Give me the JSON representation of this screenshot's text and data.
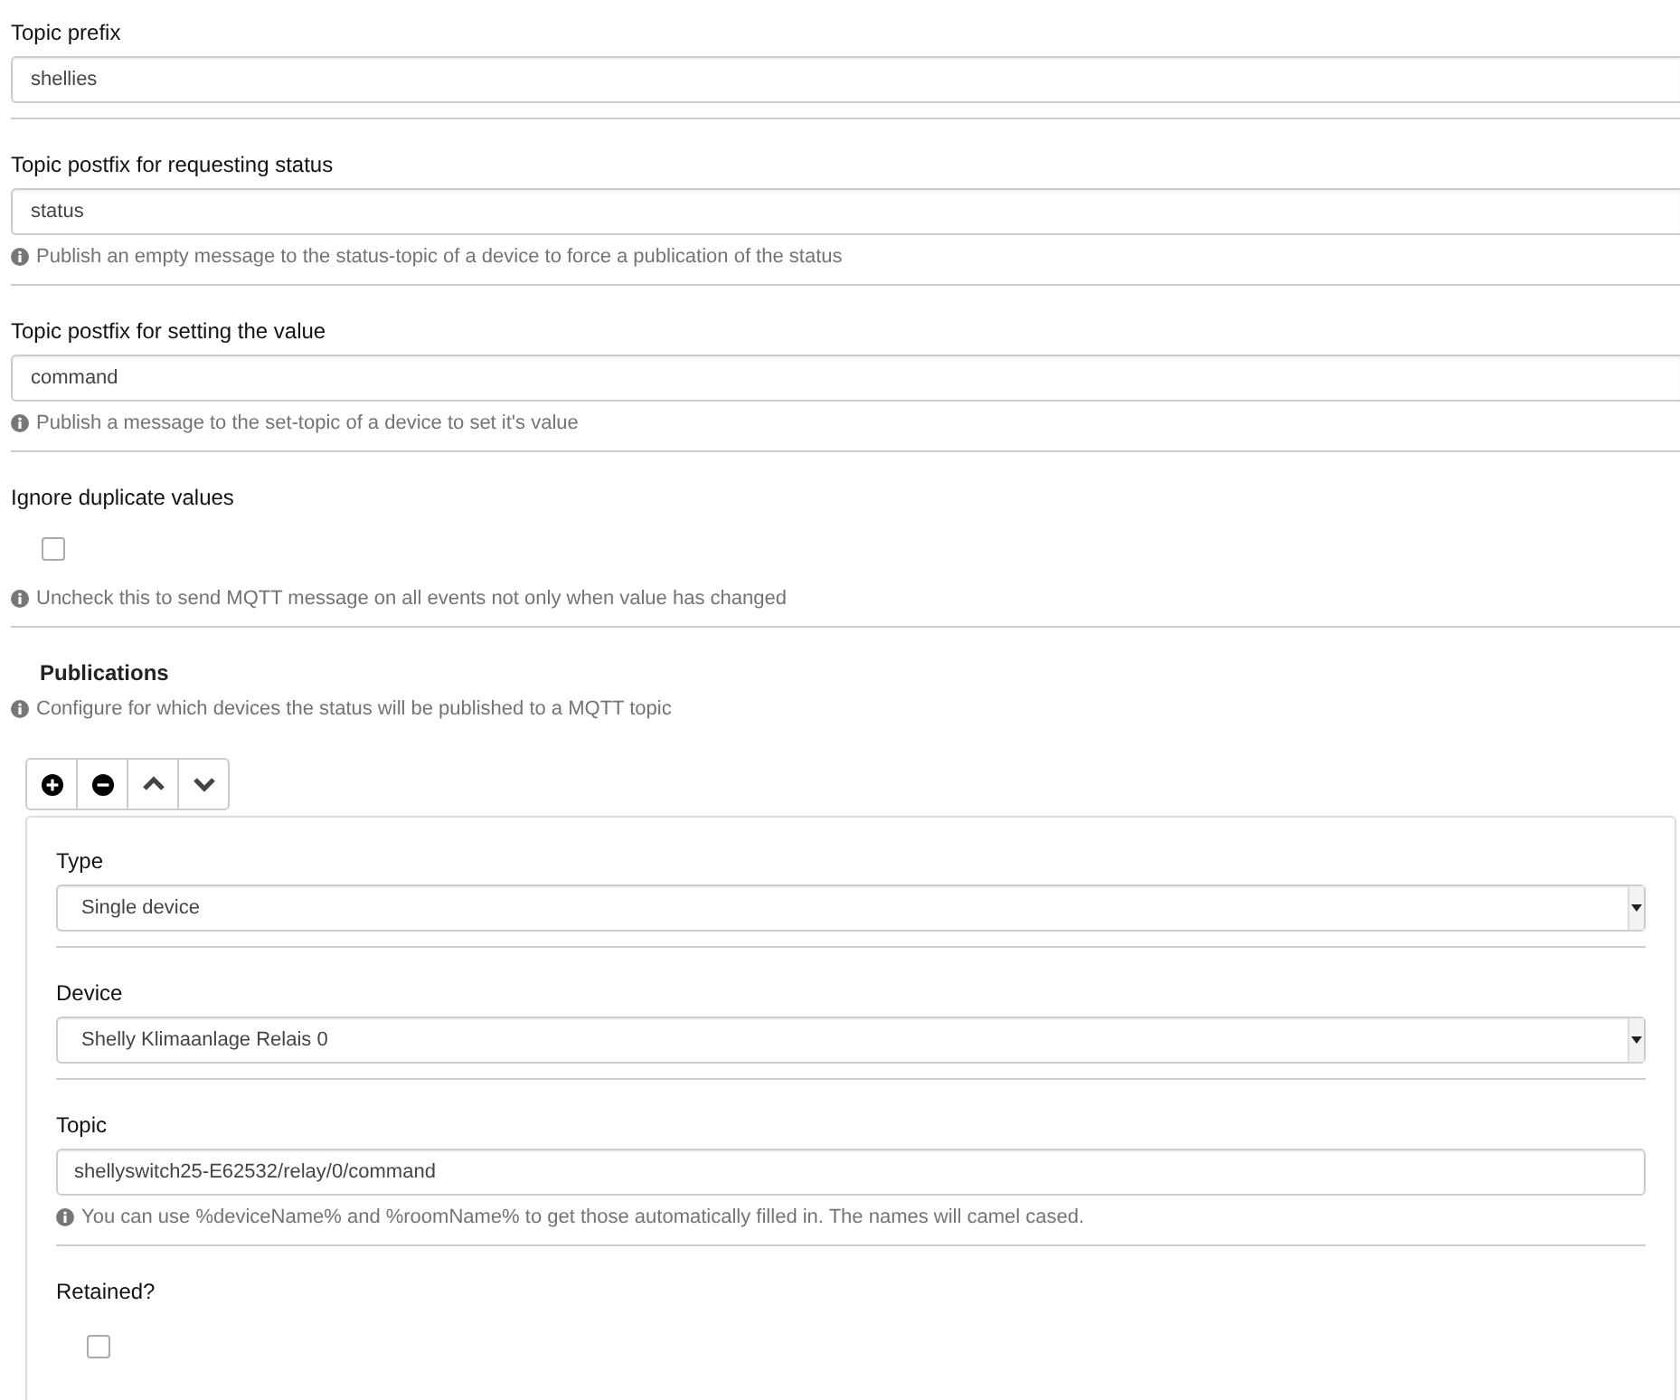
{
  "settings": [
    {
      "kind": "text",
      "label": "Topic prefix",
      "value": "shellies"
    },
    {
      "kind": "text",
      "label": "Topic postfix for requesting status",
      "value": "status",
      "help": "Publish an empty message to the status-topic of a device to force a publication of the status"
    },
    {
      "kind": "text",
      "label": "Topic postfix for setting the value",
      "value": "command",
      "help": "Publish a message to the set-topic of a device to set it's value"
    },
    {
      "kind": "checkbox",
      "label": "Ignore duplicate values",
      "checked": false,
      "help": "Uncheck this to send MQTT message on all events not only when value has changed"
    }
  ],
  "publications": {
    "title": "Publications",
    "help": "Configure for which devices the status will be published to a MQTT topic",
    "toolbar": [
      {
        "kind": "add"
      },
      {
        "kind": "remove"
      },
      {
        "kind": "up"
      },
      {
        "kind": "down"
      }
    ],
    "fields": [
      {
        "kind": "select",
        "label": "Type",
        "value": "Single device"
      },
      {
        "kind": "select",
        "label": "Device",
        "value": "Shelly Klimaanlage Relais 0"
      },
      {
        "kind": "text",
        "label": "Topic",
        "value": "shellyswitch25-E62532/relay/0/command",
        "help": "You can use %deviceName% and %roomName% to get those automatically filled in. The names will camel cased."
      },
      {
        "kind": "checkbox",
        "label": "Retained?",
        "checked": false
      }
    ]
  }
}
